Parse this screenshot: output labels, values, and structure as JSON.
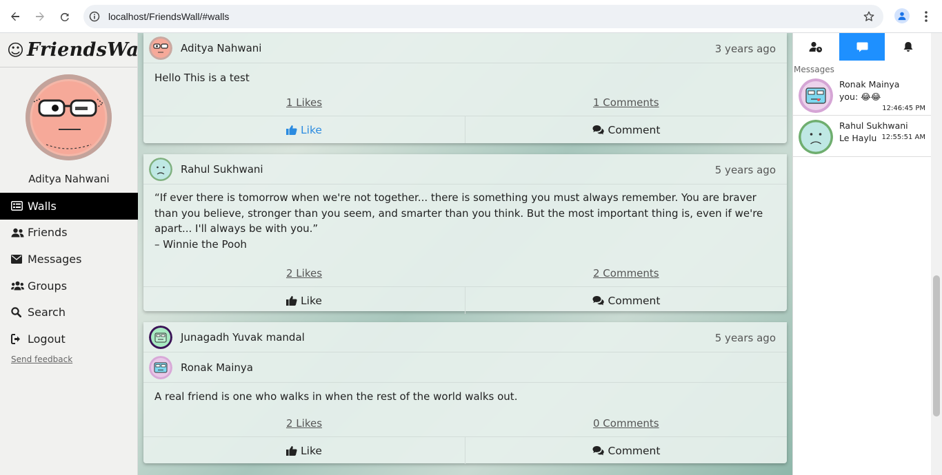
{
  "browser": {
    "url": "localhost/FriendsWall/#walls",
    "icons": [
      "back-arrow-icon",
      "forward-arrow-icon",
      "reload-icon",
      "info-icon",
      "star-icon",
      "profile-icon",
      "kebab-menu-icon"
    ]
  },
  "sidebar": {
    "brand": "FriendsWall",
    "user_name": "Aditya Nahwani",
    "items": [
      {
        "label": "Walls",
        "icon": "walls-icon",
        "active": true
      },
      {
        "label": "Friends",
        "icon": "friends-icon"
      },
      {
        "label": "Messages",
        "icon": "envelope-icon"
      },
      {
        "label": "Groups",
        "icon": "groups-icon"
      },
      {
        "label": "Search",
        "icon": "search-icon"
      },
      {
        "label": "Logout",
        "icon": "logout-icon"
      }
    ],
    "feedback": "Send feedback"
  },
  "posts": [
    {
      "author": "Aditya Nahwani",
      "time": "3 years ago",
      "text": "Hello This is a test",
      "likes": "1 Likes",
      "comments": "1 Comments",
      "like_label": "Like",
      "comment_label": "Comment",
      "liked": true
    },
    {
      "author": "Rahul Sukhwani",
      "time": "5 years ago",
      "text_lines": [
        "“If ever there is tomorrow when we're not together... there is something you must always remember. You are braver than you believe, stronger than you seem, and smarter than you think. But the most important thing is, even if we're apart... I'll always be with you.”",
        "– Winnie the Pooh"
      ],
      "likes": "2 Likes",
      "comments": "2 Comments",
      "like_label": "Like",
      "comment_label": "Comment"
    },
    {
      "group": "Junagadh Yuvak mandal",
      "author": "Ronak Mainya",
      "time": "5 years ago",
      "text": "A real friend is one who walks in when the rest of the world walks out.",
      "likes": "2 Likes",
      "comments": "0 Comments",
      "like_label": "Like",
      "comment_label": "Comment"
    }
  ],
  "rpanel": {
    "tabs": [
      {
        "icon": "add-friend-icon"
      },
      {
        "icon": "chat-icon",
        "active": true
      },
      {
        "icon": "bell-icon"
      }
    ],
    "title": "Messages",
    "messages": [
      {
        "name": "Ronak Mainya",
        "text": "you: 😂😂",
        "time": "12:46:45 PM"
      },
      {
        "name": "Rahul Sukhwani",
        "text": "Le Haylu",
        "time": "12:55:51 AM"
      }
    ]
  },
  "colors": {
    "accent": "#1e90ff",
    "liked": "#2b8be0",
    "active_nav": "#000000"
  }
}
